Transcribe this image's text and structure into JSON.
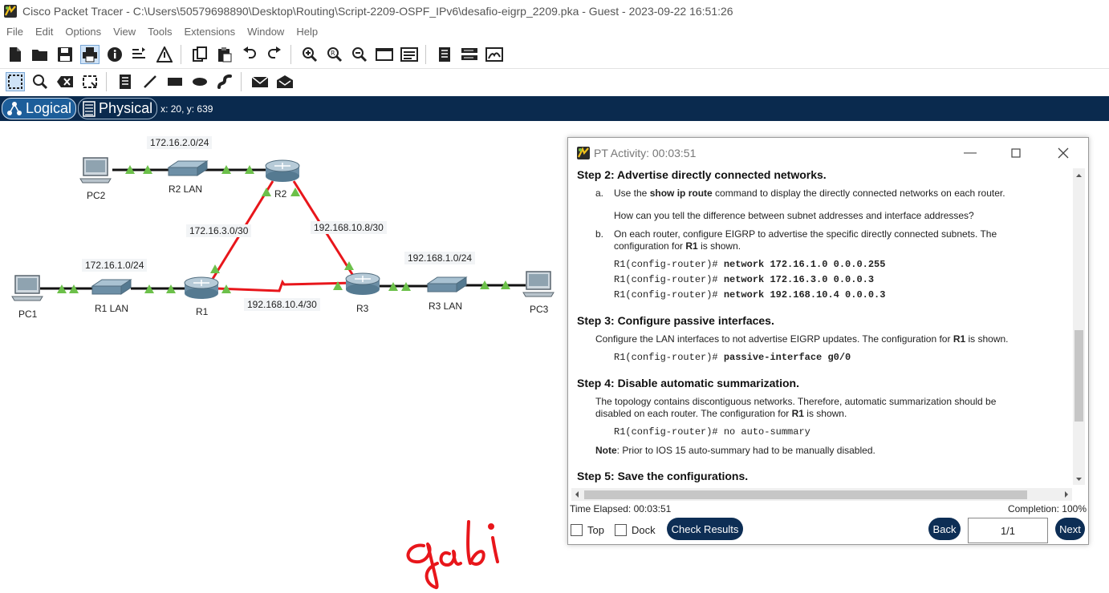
{
  "window": {
    "title": "Cisco Packet Tracer - C:\\Users\\50579698890\\Desktop\\Routing\\Script-2209-OSPF_IPv6\\desafio-eigrp_2209.pka - Guest - 2023-09-22 16:51:26"
  },
  "menu": [
    "File",
    "Edit",
    "Options",
    "View",
    "Tools",
    "Extensions",
    "Window",
    "Help"
  ],
  "mode": {
    "logical": "Logical",
    "physical": "Physical",
    "coords": "x: 20, y: 639"
  },
  "topology": {
    "networks": {
      "r2_lan": "172.16.2.0/24",
      "r1_r2": "172.16.3.0/30",
      "r2_r3": "192.168.10.8/30",
      "r1_lan": "172.16.1.0/24",
      "r3_lan": "192.168.1.0/24",
      "r1_r3": "192.168.10.4/30"
    },
    "devices": {
      "pc1": "PC1",
      "pc2": "PC2",
      "pc3": "PC3",
      "r1": "R1",
      "r2": "R2",
      "r3": "R3",
      "sw1": "R1 LAN",
      "sw2": "R2 LAN",
      "sw3": "R3 LAN"
    },
    "link_color": "#e8161b",
    "port_color": "#6cc04a"
  },
  "signature_text": "gabi",
  "activity": {
    "title": "PT Activity: 00:03:51",
    "step2": {
      "heading": "Step 2: Advertise directly connected networks.",
      "a_letter": "a.",
      "a_pre": "Use the ",
      "a_bold": "show ip route",
      "a_post": " command to display the directly connected networks on each router.",
      "question": "How can you tell the difference between subnet addresses and interface addresses?",
      "b_letter": "b.",
      "b_line1": "On each router, configure EIGRP to advertise the specific directly connected subnets. The",
      "b_line2_pre": "configuration for ",
      "b_line2_bold": "R1",
      "b_line2_post": " is shown.",
      "prompt": "R1(config-router)#",
      "cmd1": "network 172.16.1.0 0.0.0.255",
      "cmd2": "network 172.16.3.0 0.0.0.3",
      "cmd3": "network 192.168.10.4 0.0.0.3"
    },
    "step3": {
      "heading": "Step 3: Configure passive interfaces.",
      "text_pre": "Configure the LAN interfaces to not advertise EIGRP updates. The configuration for ",
      "text_bold": "R1",
      "text_post": " is shown.",
      "cmd": "passive-interface g0/0"
    },
    "step4": {
      "heading": "Step 4: Disable automatic summarization.",
      "line1": "The topology contains discontiguous networks. Therefore, automatic summarization should be",
      "line2_pre": "disabled on each router. The configuration for ",
      "line2_bold": "R1",
      "line2_post": " is shown.",
      "cmd": "no auto-summary",
      "note_bold": "Note",
      "note_text": ": Prior to IOS 15 auto-summary had to be manually disabled."
    },
    "step5": {
      "heading": "Step 5: Save the configurations."
    },
    "footer": {
      "time_elapsed": "Time Elapsed: 00:03:51",
      "completion": "Completion: 100%",
      "top": "Top",
      "dock": "Dock",
      "check_results": "Check Results",
      "back": "Back",
      "page": "1/1",
      "next": "Next"
    }
  }
}
